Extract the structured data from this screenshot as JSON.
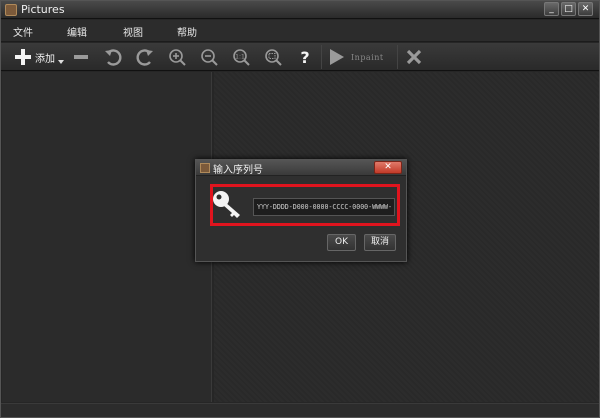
{
  "window": {
    "title": "Pictures",
    "buttons": [
      "_",
      "□",
      "✕"
    ]
  },
  "menu": {
    "items": [
      "文件",
      "编辑",
      "视图",
      "帮助"
    ]
  },
  "toolbar": {
    "add_label": "添加",
    "inpaint_label": "Inpaint"
  },
  "dialog": {
    "title": "输入序列号",
    "close_label": "✕",
    "serial_value": "YYY-DDDD-D000-0000-CCCC-0000-WWWW-",
    "ok_label": "OK",
    "cancel_label": "取消"
  },
  "colors": {
    "highlight": "#e0141e",
    "background": "#262626"
  },
  "icons": [
    "plus-icon",
    "minus-icon",
    "undo-icon",
    "redo-icon",
    "zoom-in-icon",
    "zoom-out-icon",
    "actual-size-icon",
    "fit-icon",
    "help-icon",
    "play-icon",
    "close-x-icon",
    "key-icon"
  ]
}
